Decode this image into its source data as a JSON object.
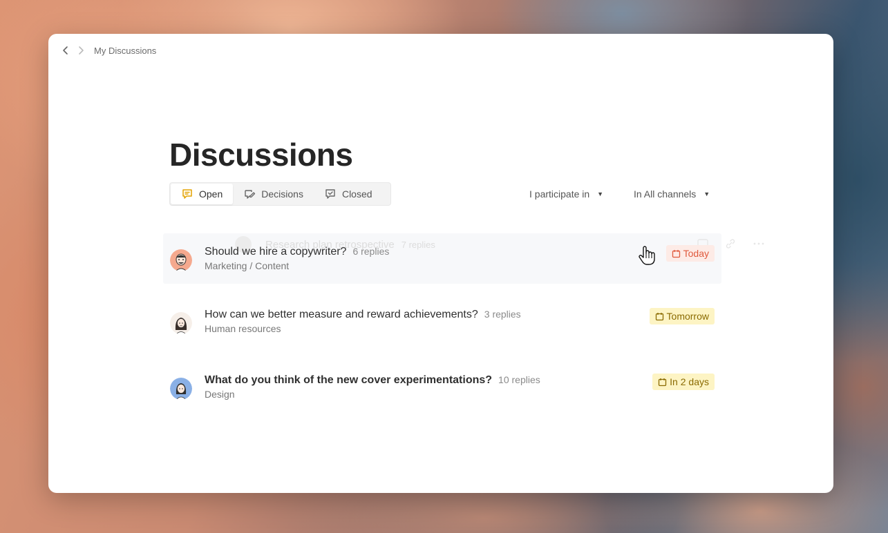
{
  "colors": {
    "today_bg": "#fdebe6",
    "today_text": "#e0593c",
    "upcoming_bg": "#fdf4c4",
    "upcoming_text": "#8a6a00",
    "tab_active_icon": "#e3a200"
  },
  "nav": {
    "back_icon": "chevron-left-icon",
    "forward_icon": "chevron-right-icon",
    "breadcrumb": "My Discussions"
  },
  "page": {
    "title": "Discussions"
  },
  "tabs": [
    {
      "label": "Open",
      "icon": "chat-bubble-icon",
      "active": true
    },
    {
      "label": "Decisions",
      "icon": "decision-icon",
      "active": false
    },
    {
      "label": "Closed",
      "icon": "closed-check-icon",
      "active": false
    }
  ],
  "filters": {
    "participation": "I participate in",
    "channels": "In All channels"
  },
  "ghost_row": {
    "title": "Research plan retrospective",
    "replies": "7 replies"
  },
  "discussions": [
    {
      "title": "Should we hire a copywriter?",
      "replies": "6 replies",
      "channel": "Marketing / Content",
      "due": "Today",
      "due_icon": "calendar-icon",
      "avatar": "man-avatar"
    },
    {
      "title": "How can we better measure and reward achievements?",
      "replies": "3 replies",
      "channel": "Human resources",
      "due": "Tomorrow",
      "due_icon": "calendar-icon",
      "avatar": "woman-avatar"
    },
    {
      "title": "What do you think of the new cover experimentations?",
      "replies": "10 replies",
      "channel": "Design",
      "due": "In 2 days",
      "due_icon": "calendar-icon",
      "avatar": "person-avatar"
    }
  ]
}
